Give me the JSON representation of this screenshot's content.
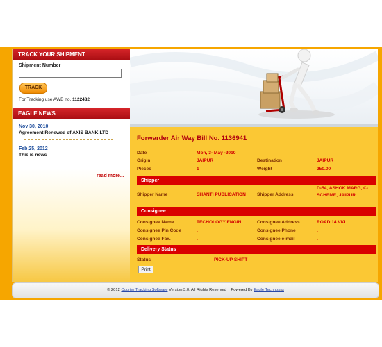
{
  "sidebar": {
    "track_title": "TRACK YOUR SHIPMENT",
    "shipment_label": "Shipment Number",
    "shipment_value": "",
    "track_button": "TRACK",
    "awb_note_prefix": "For Tracking use AWB no.",
    "awb_note_number": "1122482",
    "news_title": "EAGLE NEWS",
    "news": [
      {
        "date": "Nov 30, 2010",
        "text": "Agreement Renewed of AXIS BANK LTD"
      },
      {
        "date": "Feb 25, 2012",
        "text": "This is news"
      }
    ],
    "read_more": "read more..."
  },
  "main": {
    "title": "Forwarder Air Way Bill No. 1136941",
    "date_label": "Date",
    "date_value": "Mon, 3- May -2010",
    "origin_label": "Origin",
    "origin_value": "JAIPUR",
    "destination_label": "Destination",
    "destination_value": "JAIPUR",
    "pieces_label": "Pieces",
    "pieces_value": "1",
    "weight_label": "Weight",
    "weight_value": "250.00",
    "shipper_section": "Shipper",
    "shipper_name_label": "Shipper Name",
    "shipper_name_value": "SHANTI PUBLICATION",
    "shipper_address_label": "Shipper Address",
    "shipper_address_value": "D-54, ASHOK MARG, C-SCHEME, JAIPUR",
    "consignee_section": "Consignee",
    "consignee_name_label": "Consignee Name",
    "consignee_name_value": "TECHOLOGY ENGIN",
    "consignee_address_label": "Consignee Address",
    "consignee_address_value": "ROAD 14 VKI",
    "consignee_pin_label": "Consignee Pin Code",
    "consignee_pin_value": ".",
    "consignee_phone_label": "Consignee Phone",
    "consignee_phone_value": ".",
    "consignee_fax_label": "Consignee Fax.",
    "consignee_fax_value": ".",
    "consignee_email_label": "Consignee e-mail",
    "consignee_email_value": ".",
    "delivery_section": "Delivery Status",
    "status_label": "Status",
    "status_value": "PICK-UP SHIPT",
    "print_button": "Print"
  },
  "footer": {
    "copyright": "© 2012",
    "software_link": "Courier Tracking Software",
    "version_text": "Version 3.0. All Rights Reserved",
    "powered_by": "Powered By",
    "company_link": "Eagle Technosys"
  },
  "colors": {
    "accent_red": "#d90000",
    "frame_orange": "#f6a600",
    "content_yellow": "#fbc834"
  }
}
